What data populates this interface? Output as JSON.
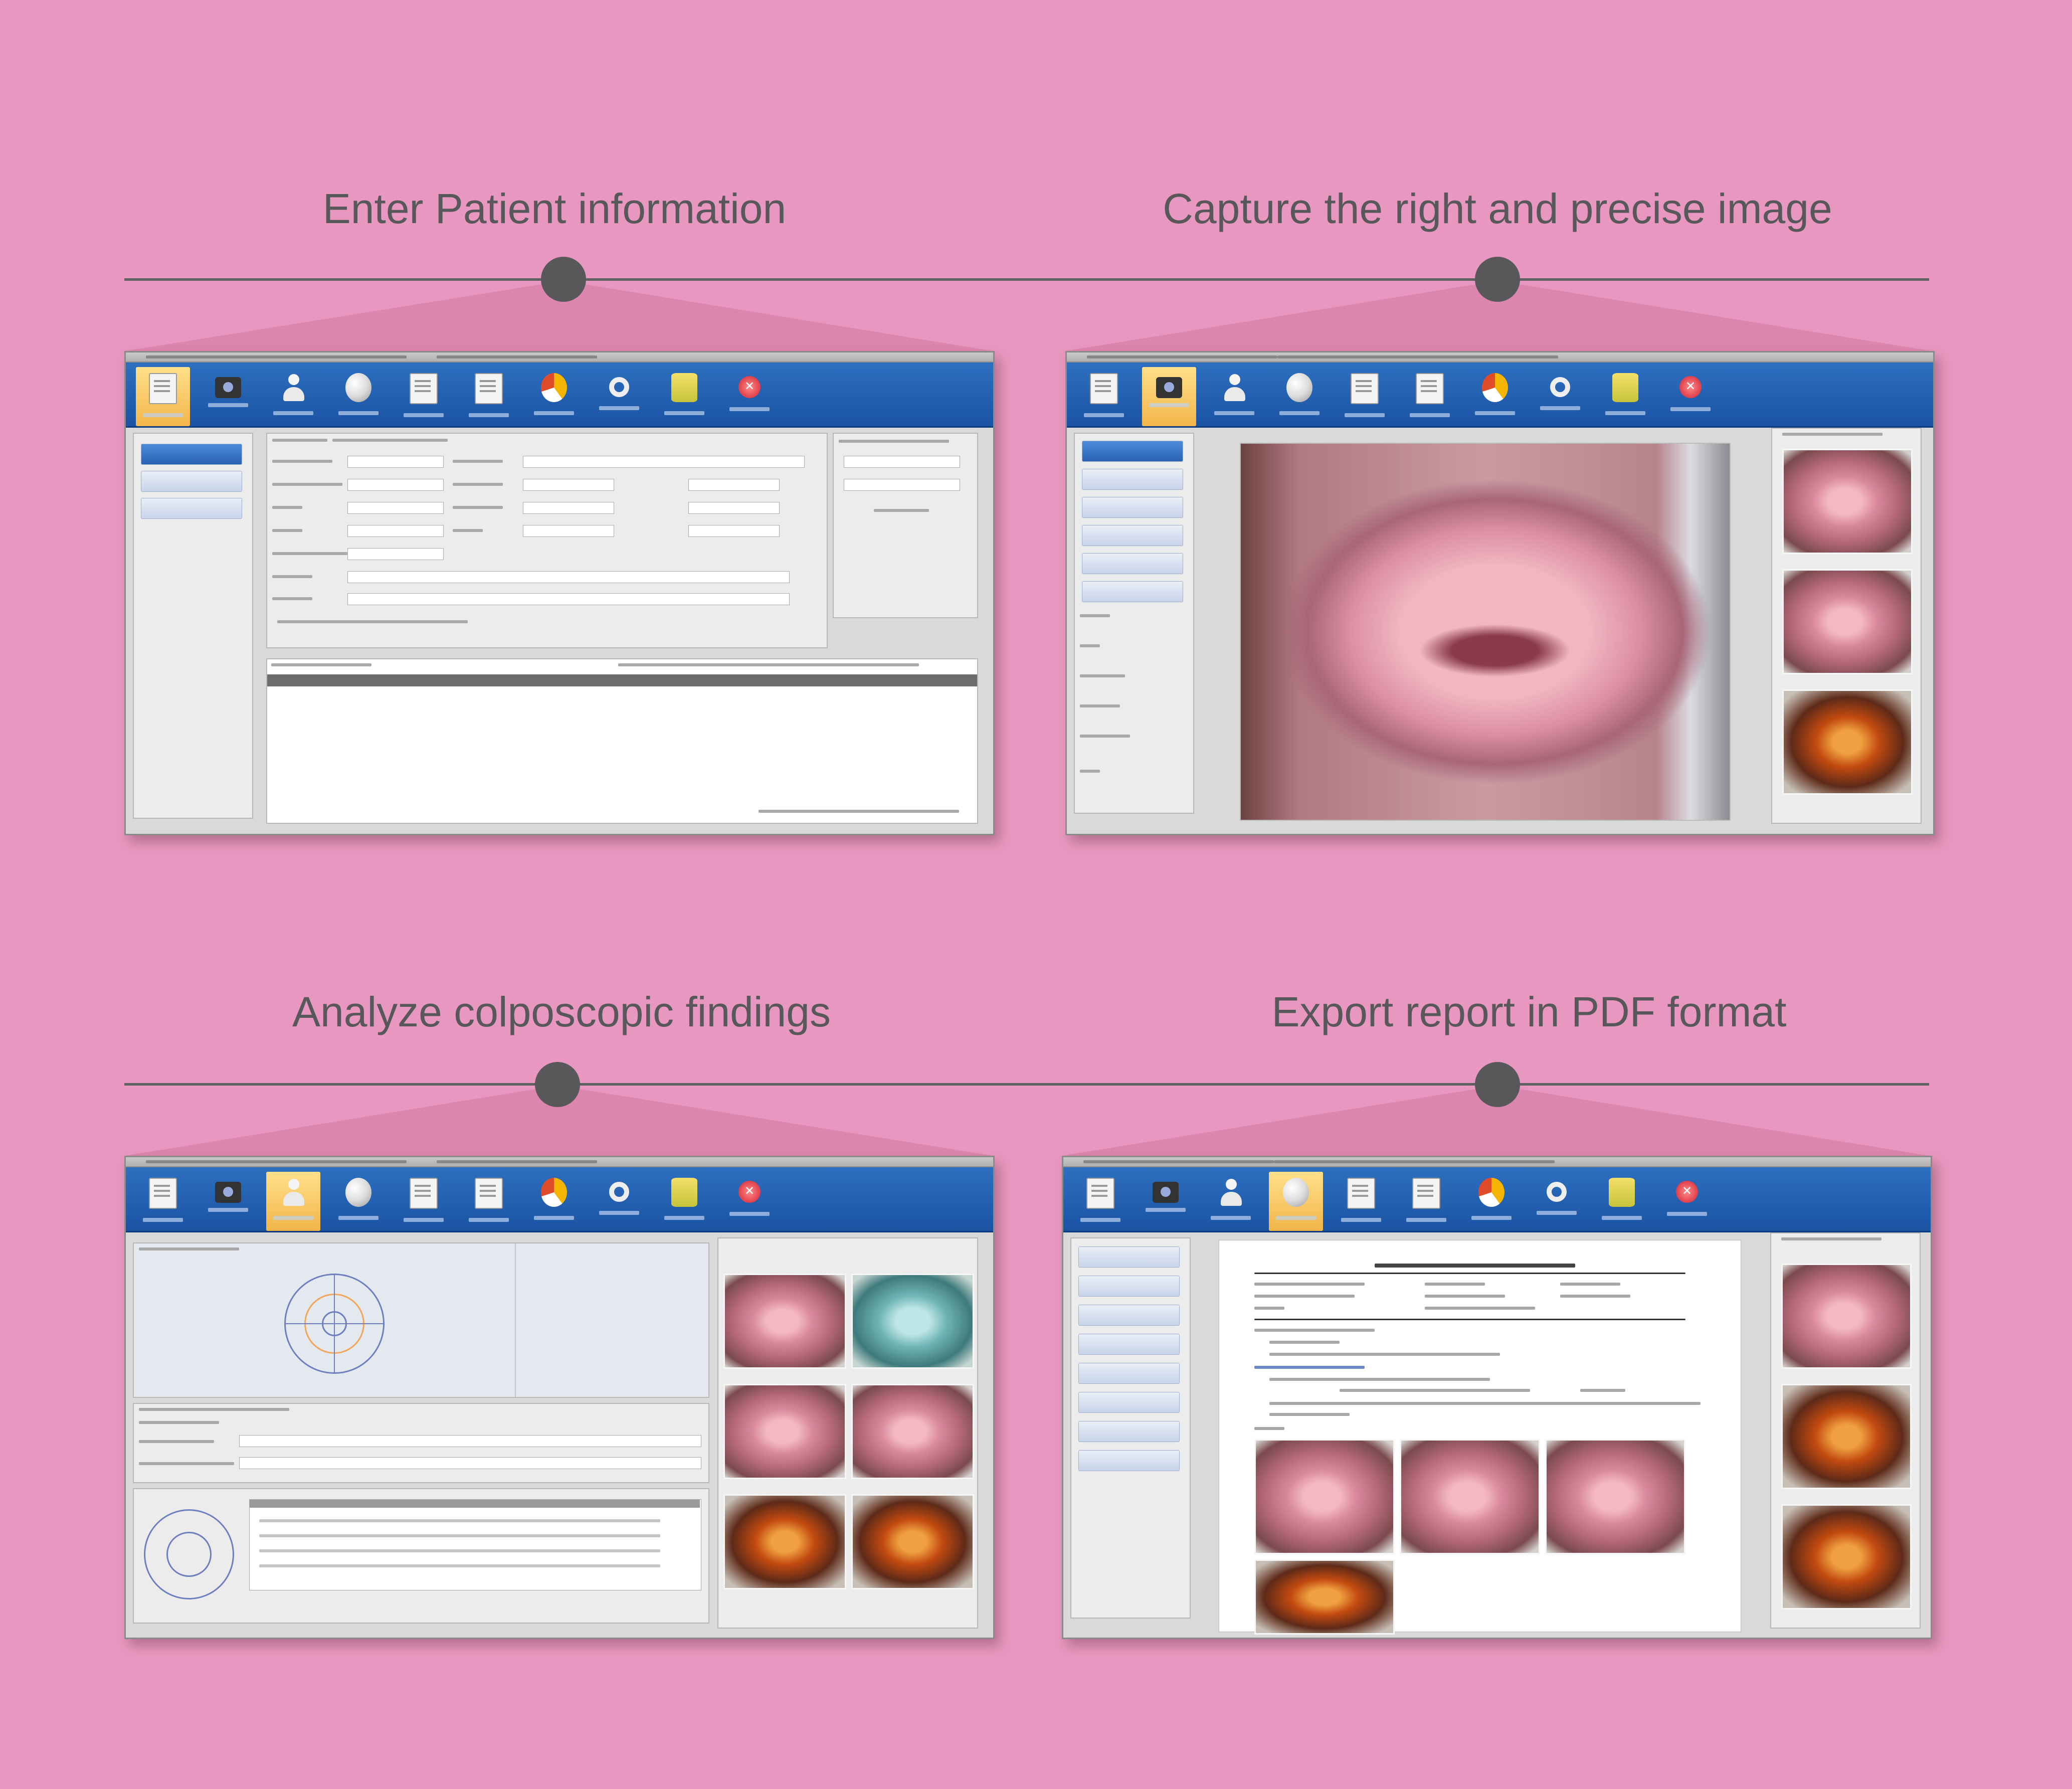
{
  "steps": [
    {
      "title": "Enter Patient information"
    },
    {
      "title": "Capture the right and precise image"
    },
    {
      "title": "Analyze colposcopic findings"
    },
    {
      "title": "Export report in PDF format"
    }
  ],
  "toolbar_icons": [
    "patient-info-icon",
    "capture-icon",
    "assessment-icon",
    "report-icon",
    "document-icon",
    "document-icon",
    "statistics-icon",
    "settings-icon",
    "backup-icon",
    "exit-icon"
  ],
  "colors": {
    "background": "#e898c0",
    "toolbar": "#1b53a3",
    "title_text": "#58585a"
  }
}
